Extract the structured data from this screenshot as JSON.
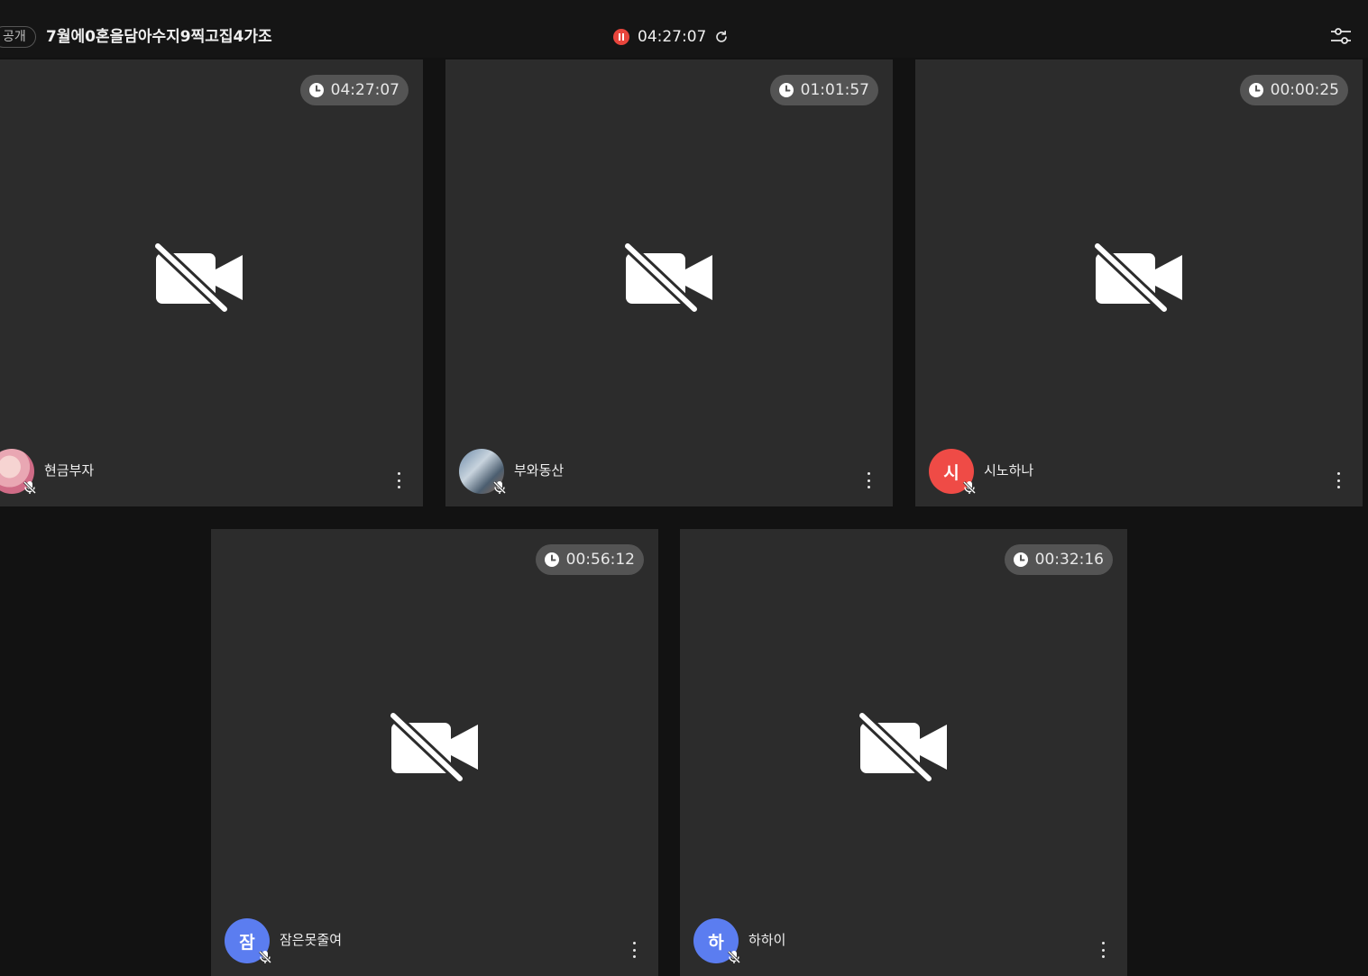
{
  "header": {
    "visibility_badge": "공개",
    "room_title": "7월에0혼을담아수지9찍고집4가조",
    "recording_time": "04:27:07"
  },
  "colors": {
    "tile_bg": "#2c2c2c",
    "page_bg": "#121212",
    "record_red": "#e8453c",
    "avatar_red": "#ef4b46",
    "avatar_blue": "#5b7df0"
  },
  "participants": [
    {
      "name": "현금부자",
      "timer": "04:27:07",
      "avatar": {
        "type": "photo",
        "icon": "avatar-photo"
      }
    },
    {
      "name": "부와동산",
      "timer": "01:01:57",
      "avatar": {
        "type": "photo",
        "icon": "avatar-photo"
      }
    },
    {
      "name": "시노하나",
      "timer": "00:00:25",
      "avatar": {
        "type": "initial",
        "initial": "시",
        "color": "#ef4b46"
      }
    },
    {
      "name": "잠은못줄여",
      "timer": "00:56:12",
      "avatar": {
        "type": "initial",
        "initial": "잠",
        "color": "#5b7df0"
      }
    },
    {
      "name": "하하이",
      "timer": "00:32:16",
      "avatar": {
        "type": "initial",
        "initial": "하",
        "color": "#5b7df0"
      }
    }
  ],
  "icons": {
    "camera": "camera-off-icon",
    "mic": "mic-off-icon",
    "timer": "clock-icon",
    "menu": "more-vertical-icon",
    "settings": "sliders-icon",
    "refresh": "refresh-icon",
    "record": "record-pause-icon"
  }
}
